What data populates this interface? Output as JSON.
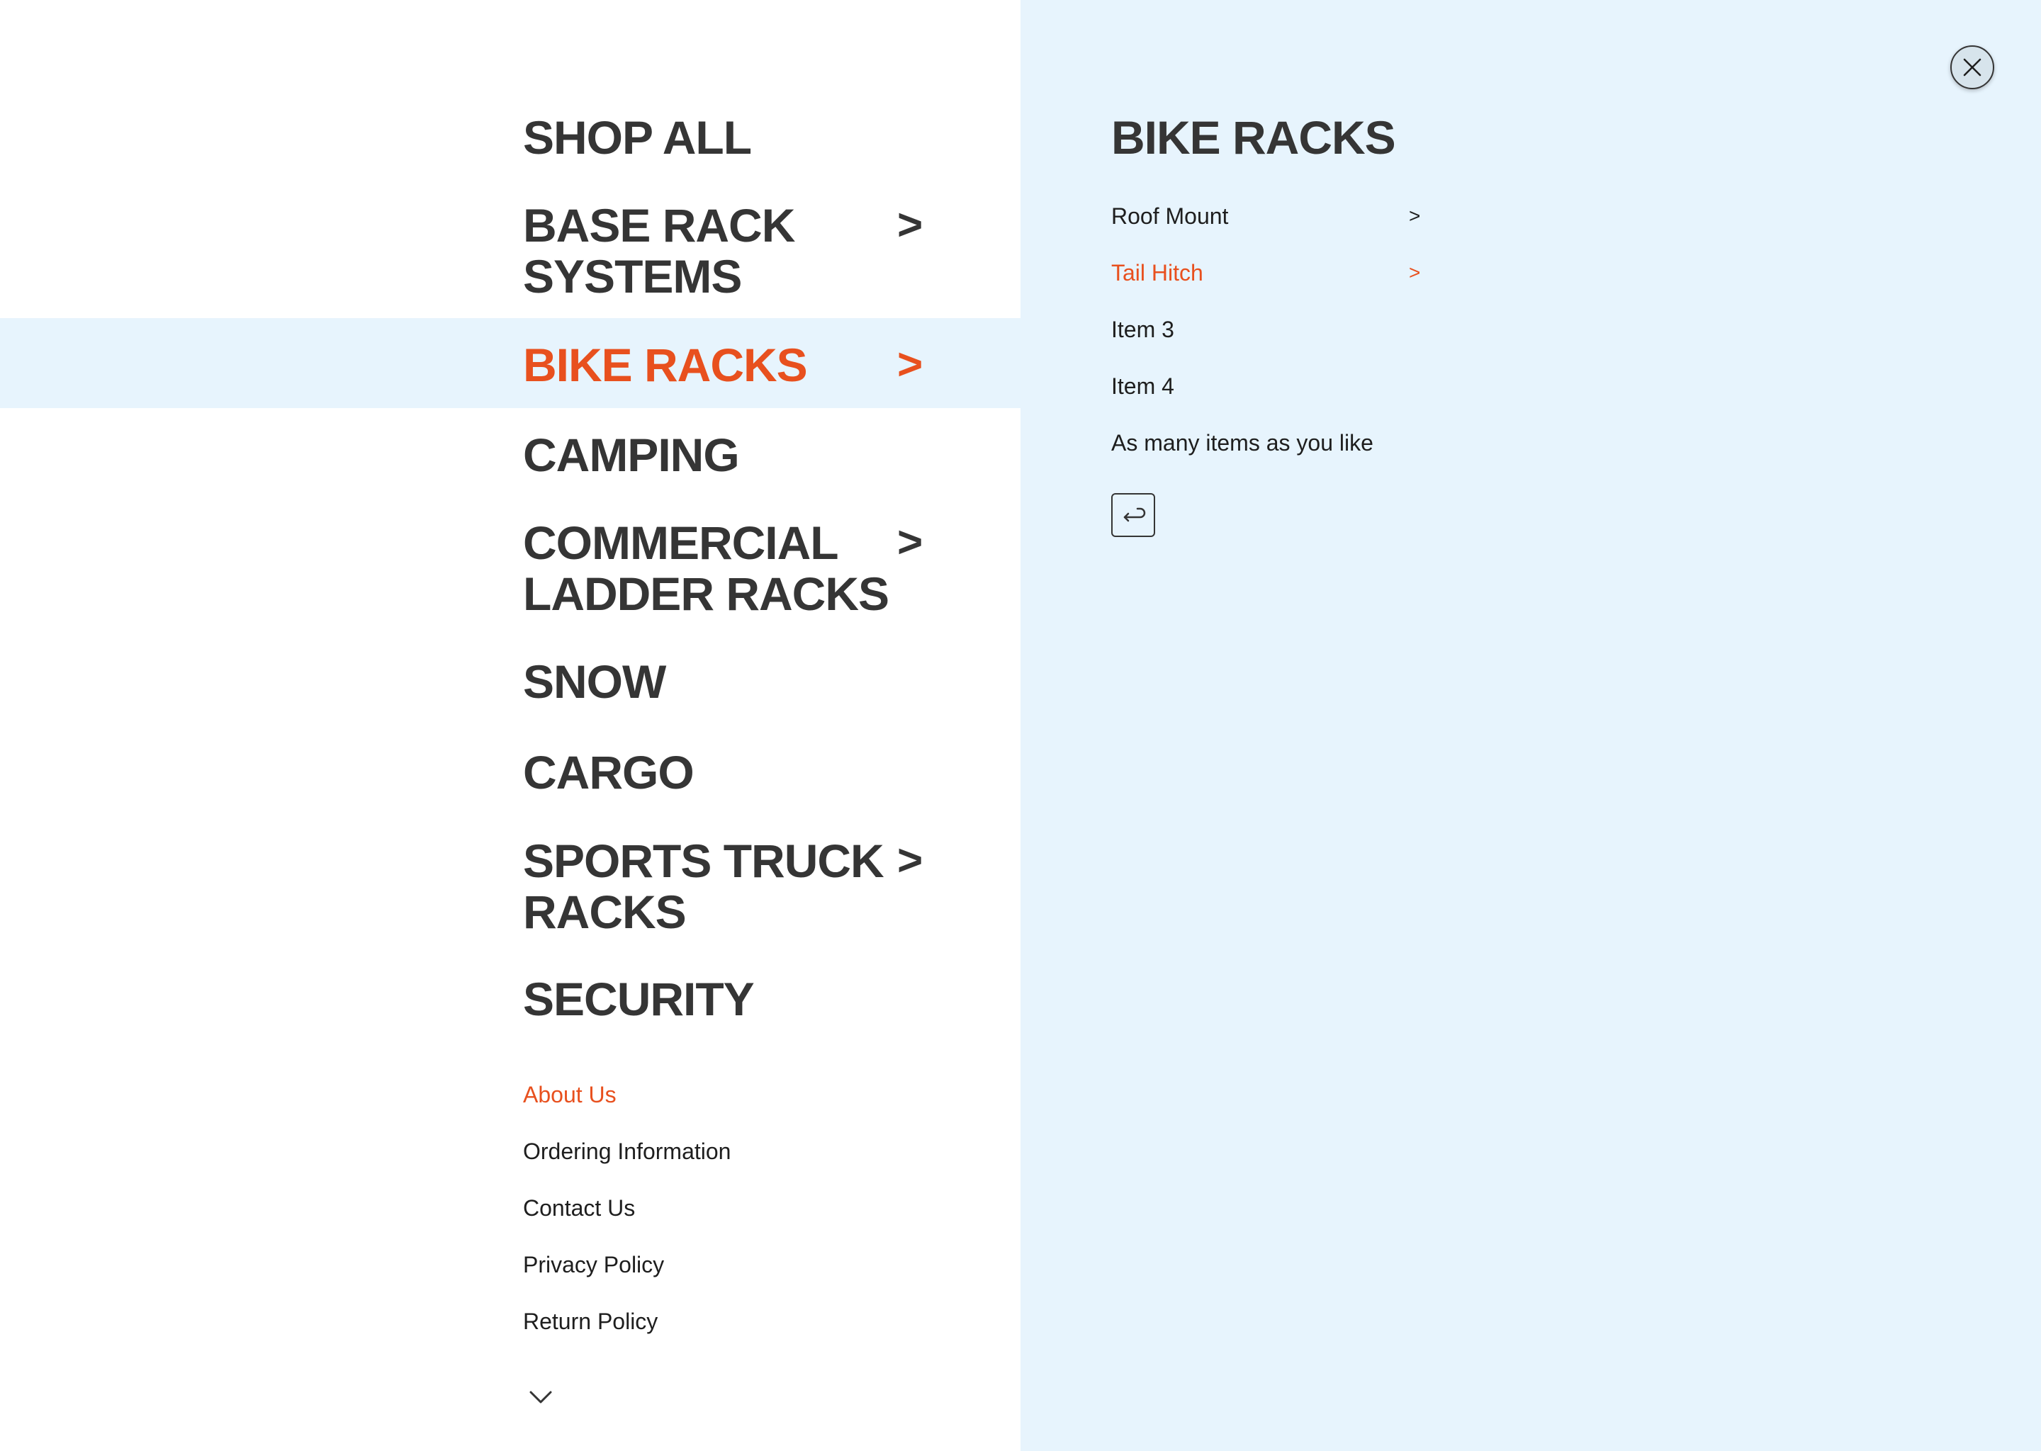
{
  "menu": {
    "items": [
      {
        "label": "SHOP ALL",
        "chevron": ""
      },
      {
        "label": "BASE RACK SYSTEMS",
        "chevron": ">"
      },
      {
        "label": "BIKE RACKS",
        "chevron": ">"
      },
      {
        "label": "CAMPING",
        "chevron": ""
      },
      {
        "label": "COMMERCIAL LADDER RACKS",
        "chevron": ">"
      },
      {
        "label": "SNOW",
        "chevron": ""
      },
      {
        "label": "CARGO",
        "chevron": ""
      },
      {
        "label": "SPORTS TRUCK RACKS",
        "chevron": ">"
      },
      {
        "label": "SECURITY",
        "chevron": ""
      }
    ],
    "active_index": 2
  },
  "footer_links": [
    "About Us",
    "Ordering Information",
    "Contact Us",
    "Privacy Policy",
    "Return Policy"
  ],
  "submenu": {
    "title": "BIKE RACKS",
    "items": [
      {
        "label": "Roof Mount",
        "chevron": ">"
      },
      {
        "label": "Tail Hitch",
        "chevron": ">"
      },
      {
        "label": "Item 3",
        "chevron": ""
      },
      {
        "label": "Item 4",
        "chevron": ""
      },
      {
        "label": "As many items as you like",
        "chevron": ""
      }
    ]
  },
  "icons": {
    "close": "close-icon",
    "back": "back-arrow-icon",
    "scroll": "chevron-down-icon"
  },
  "colors": {
    "accent": "#e8501e",
    "panel_bg": "#e7f4fd",
    "text": "#353535"
  }
}
